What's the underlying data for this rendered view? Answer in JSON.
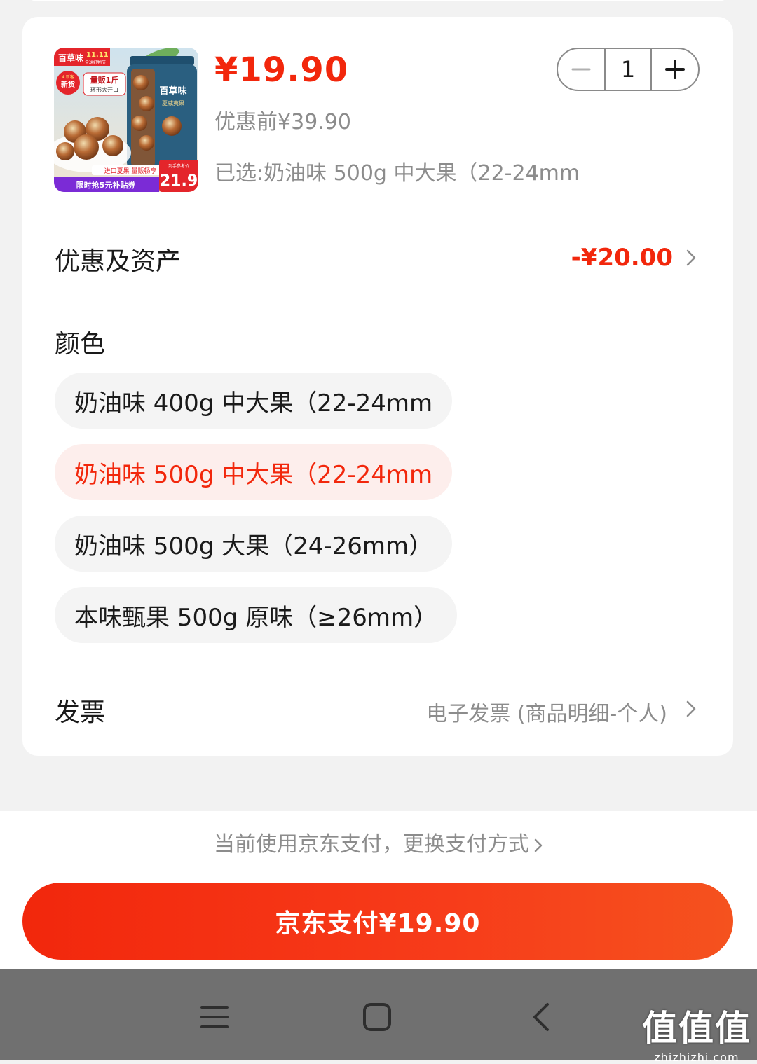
{
  "product": {
    "price": "¥19.90",
    "price_before": "优惠前¥39.90",
    "selected_spec": "已选:奶油味 500g 中大果（22-24mm",
    "quantity": "1",
    "image": {
      "brand": "百草味",
      "festival": "11.11",
      "festival_sub": "全球好物节",
      "badge_new": "新货",
      "badge_tag": "4.新客",
      "promo_volume": "量贩1斤",
      "promo_open": "环形大开口",
      "jar_brand": "百草味",
      "jar_name": "夏威夷果",
      "strip_text": "进口夏果 量贩畅享",
      "coupon_text": "限时抢5元补贴券",
      "price_tag_label": "到手参考价",
      "price_tag": "21.9"
    }
  },
  "discount": {
    "label": "优惠及资产",
    "value": "-¥20.00"
  },
  "color": {
    "label": "颜色",
    "options": [
      {
        "label": "奶油味 400g 中大果（22-24mm",
        "selected": false
      },
      {
        "label": "奶油味 500g 中大果（22-24mm",
        "selected": true
      },
      {
        "label": "奶油味 500g 大果（24-26mm）",
        "selected": false
      },
      {
        "label": "本味甄果 500g 原味（≥26mm）",
        "selected": false
      }
    ]
  },
  "invoice": {
    "label": "发票",
    "value": "电子发票 (商品明细-个人)"
  },
  "payment": {
    "method_text": "当前使用京东支付，更换支付方式",
    "button_label": "京东支付¥19.90"
  },
  "watermark": {
    "main": "值值值",
    "sub": "zhizhizhi.com"
  },
  "colors": {
    "accent": "#f2270c",
    "selected_bg": "#fdeeec",
    "navbar": "#707070"
  }
}
